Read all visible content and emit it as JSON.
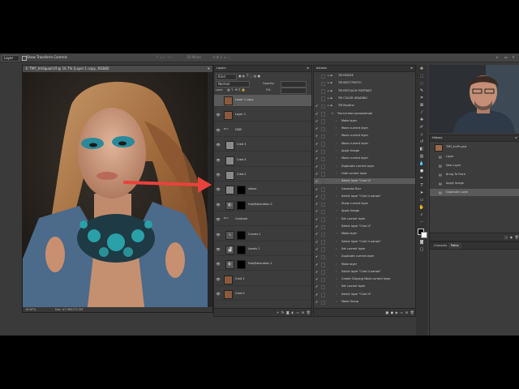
{
  "options_bar": {
    "tool_select": "Layer",
    "show_transform": "Show Transform Controls",
    "mode_3d": "3D Mode"
  },
  "document": {
    "tab_title": "© TMY_tmSquad.tif @ 16.7% (Layer 1 copy, RGB/8)",
    "zoom": "16.67%",
    "doc_size": "Doc: 47.9M/175.2M"
  },
  "layers_panel": {
    "title": "Layers",
    "filter": "Kind",
    "blend_mode": "Normal",
    "opacity_label": "Opacity:",
    "lock_label": "Lock:",
    "fill_label": "Fill:",
    "layers": [
      {
        "name": "Layer 1 copy",
        "visible": false,
        "selected": true,
        "thumb": "photo",
        "mask": false,
        "indent": 0
      },
      {
        "name": "Layer 1",
        "visible": true,
        "selected": false,
        "thumb": "photo",
        "mask": false,
        "indent": 0
      },
      {
        "name": "DDB",
        "visible": true,
        "selected": false,
        "thumb": "folder",
        "mask": false,
        "indent": 0
      },
      {
        "name": "Cred 3",
        "visible": true,
        "selected": false,
        "thumb": "gray",
        "mask": false,
        "indent": 1
      },
      {
        "name": "Cred 4",
        "visible": true,
        "selected": false,
        "thumb": "gray",
        "mask": false,
        "indent": 1
      },
      {
        "name": "Cred 2",
        "visible": true,
        "selected": false,
        "thumb": "gray",
        "mask": false,
        "indent": 1
      },
      {
        "name": "shave",
        "visible": true,
        "selected": false,
        "thumb": "gray",
        "mask": true,
        "indent": 1
      },
      {
        "name": "Hue/Saturation 2",
        "visible": true,
        "selected": false,
        "thumb": "adjust",
        "mask": true,
        "indent": 1
      },
      {
        "name": "Contrast",
        "visible": true,
        "selected": false,
        "thumb": "folder",
        "mask": false,
        "indent": 0
      },
      {
        "name": "Curves 1",
        "visible": true,
        "selected": false,
        "thumb": "curves",
        "mask": true,
        "indent": 1
      },
      {
        "name": "Levels 1",
        "visible": true,
        "selected": false,
        "thumb": "levels",
        "mask": true,
        "indent": 1
      },
      {
        "name": "Hue/Saturation 1",
        "visible": true,
        "selected": false,
        "thumb": "adjust",
        "mask": true,
        "indent": 1
      },
      {
        "name": "Cred 1",
        "visible": true,
        "selected": false,
        "thumb": "photo",
        "mask": false,
        "indent": 0
      },
      {
        "name": "Cred 0",
        "visible": true,
        "selected": false,
        "thumb": "photo",
        "mask": false,
        "indent": 0
      }
    ]
  },
  "actions_panel": {
    "title": "Actions",
    "items": [
      {
        "name": "TM RESIZE",
        "check": false,
        "folder": true,
        "indent": 0
      },
      {
        "name": "TM BEST PHOTO",
        "check": false,
        "folder": true,
        "indent": 0
      },
      {
        "name": "TM RETOUCH PORTRAIT",
        "check": false,
        "folder": true,
        "indent": 0
      },
      {
        "name": "TM COLOR GRADING",
        "check": false,
        "folder": true,
        "indent": 0
      },
      {
        "name": "TM Routine",
        "check": true,
        "folder": true,
        "indent": 0
      },
      {
        "name": "Частотное разложение",
        "check": true,
        "folder": false,
        "indent": 1
      },
      {
        "name": "Make layer",
        "check": true,
        "folder": false,
        "indent": 2
      },
      {
        "name": "Move current layer",
        "check": true,
        "folder": false,
        "indent": 2
      },
      {
        "name": "Move current layer",
        "check": true,
        "folder": false,
        "indent": 2
      },
      {
        "name": "Move current layer",
        "check": true,
        "folder": false,
        "indent": 2
      },
      {
        "name": "Apply Image",
        "check": true,
        "folder": false,
        "indent": 2
      },
      {
        "name": "Move current layer",
        "check": true,
        "folder": false,
        "indent": 2
      },
      {
        "name": "Duplicate current layer",
        "check": true,
        "folder": false,
        "indent": 2
      },
      {
        "name": "Hide current layer",
        "check": true,
        "folder": false,
        "indent": 2
      },
      {
        "name": "Select layer \"Cred 4\"",
        "check": true,
        "folder": false,
        "indent": 2,
        "selected": true
      },
      {
        "name": "Gaussian Blur",
        "check": true,
        "folder": false,
        "indent": 2
      },
      {
        "name": "Select layer \"Cred 4 копия\"",
        "check": true,
        "folder": false,
        "indent": 2
      },
      {
        "name": "Show current layer",
        "check": true,
        "folder": false,
        "indent": 2
      },
      {
        "name": "Apply Image",
        "check": true,
        "folder": false,
        "indent": 2
      },
      {
        "name": "Set current layer",
        "check": true,
        "folder": false,
        "indent": 2
      },
      {
        "name": "Select layer \"Cred 4\"",
        "check": true,
        "folder": false,
        "indent": 2
      },
      {
        "name": "Make layer",
        "check": true,
        "folder": false,
        "indent": 2
      },
      {
        "name": "Select layer \"Cred 4 копия\"",
        "check": true,
        "folder": false,
        "indent": 2
      },
      {
        "name": "Set current layer",
        "check": true,
        "folder": false,
        "indent": 2
      },
      {
        "name": "Duplicate current layer",
        "check": true,
        "folder": false,
        "indent": 2
      },
      {
        "name": "Make layer",
        "check": true,
        "folder": false,
        "indent": 2
      },
      {
        "name": "Select layer \"Cred 4 копия\"",
        "check": true,
        "folder": false,
        "indent": 2
      },
      {
        "name": "Create Clipping Mask current layer",
        "check": true,
        "folder": false,
        "indent": 2
      },
      {
        "name": "Set current layer",
        "check": true,
        "folder": false,
        "indent": 2
      },
      {
        "name": "Select layer \"Cred 4\"",
        "check": true,
        "folder": false,
        "indent": 2
      },
      {
        "name": "Make Group",
        "check": true,
        "folder": false,
        "indent": 2
      }
    ]
  },
  "history_panel": {
    "title": "History",
    "snapshot": "TMY_tmPs.psd",
    "items": [
      {
        "name": "Layer",
        "selected": false
      },
      {
        "name": "New Layer",
        "selected": false
      },
      {
        "name": "Bring To Front",
        "selected": false
      },
      {
        "name": "Apply Image",
        "selected": false
      },
      {
        "name": "Duplicate Layer",
        "selected": true
      }
    ]
  },
  "channels_panel": {
    "tab_channels": "Channels",
    "tab_paths": "Paths"
  },
  "colors": {
    "arrow": "#e8423c",
    "selected_row": "#5a5a5a",
    "panel_bg": "#3c3c3c",
    "app_bg": "#3a3a3a"
  }
}
